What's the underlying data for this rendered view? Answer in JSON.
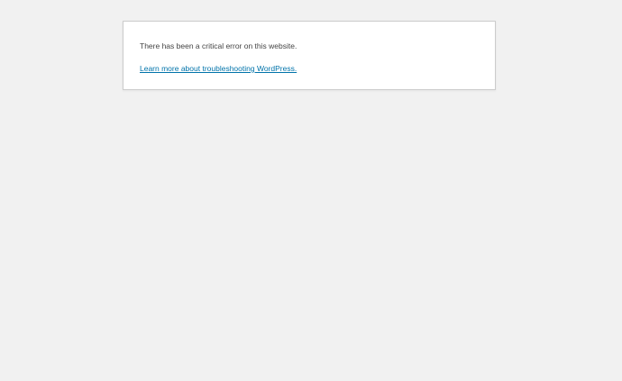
{
  "error_page": {
    "message": "There has been a critical error on this website.",
    "help_link_text": "Learn more about troubleshooting WordPress."
  },
  "colors": {
    "page_background": "#f1f1f1",
    "box_background": "#ffffff",
    "box_border": "#cccccc",
    "text": "#444444",
    "link": "#0073aa"
  }
}
